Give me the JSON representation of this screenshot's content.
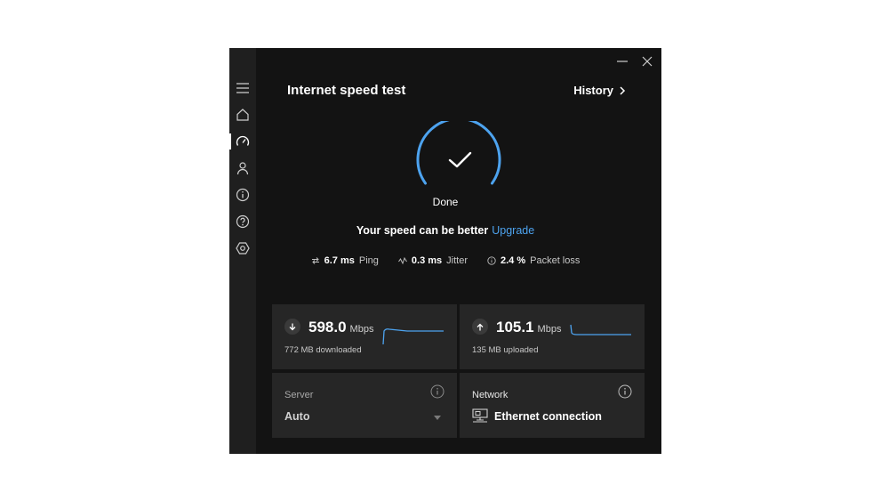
{
  "window": {
    "title": "Internet speed test",
    "history_label": "History"
  },
  "sidebar": {
    "items": [
      {
        "icon": "menu-icon"
      },
      {
        "icon": "home-icon"
      },
      {
        "icon": "speedometer-icon",
        "active": true
      },
      {
        "icon": "account-icon"
      },
      {
        "icon": "info-icon"
      },
      {
        "icon": "help-icon"
      },
      {
        "icon": "settings-icon"
      }
    ]
  },
  "test": {
    "status": "Done",
    "message": "Your speed can be better",
    "upgrade_label": "Upgrade"
  },
  "stats": {
    "ping_value": "6.7 ms",
    "ping_label": "Ping",
    "jitter_value": "0.3 ms",
    "jitter_label": "Jitter",
    "loss_value": "2.4 %",
    "loss_label": "Packet loss"
  },
  "download": {
    "speed": "598.0",
    "unit": "Mbps",
    "detail": "772 MB downloaded"
  },
  "upload": {
    "speed": "105.1",
    "unit": "Mbps",
    "detail": "135 MB uploaded"
  },
  "server": {
    "label": "Server",
    "value": "Auto"
  },
  "network": {
    "label": "Network",
    "value": "Ethernet connection"
  },
  "colors": {
    "accent": "#4da3ef",
    "background": "#131313",
    "sidebar": "#1f1f1f",
    "card": "#262626"
  }
}
